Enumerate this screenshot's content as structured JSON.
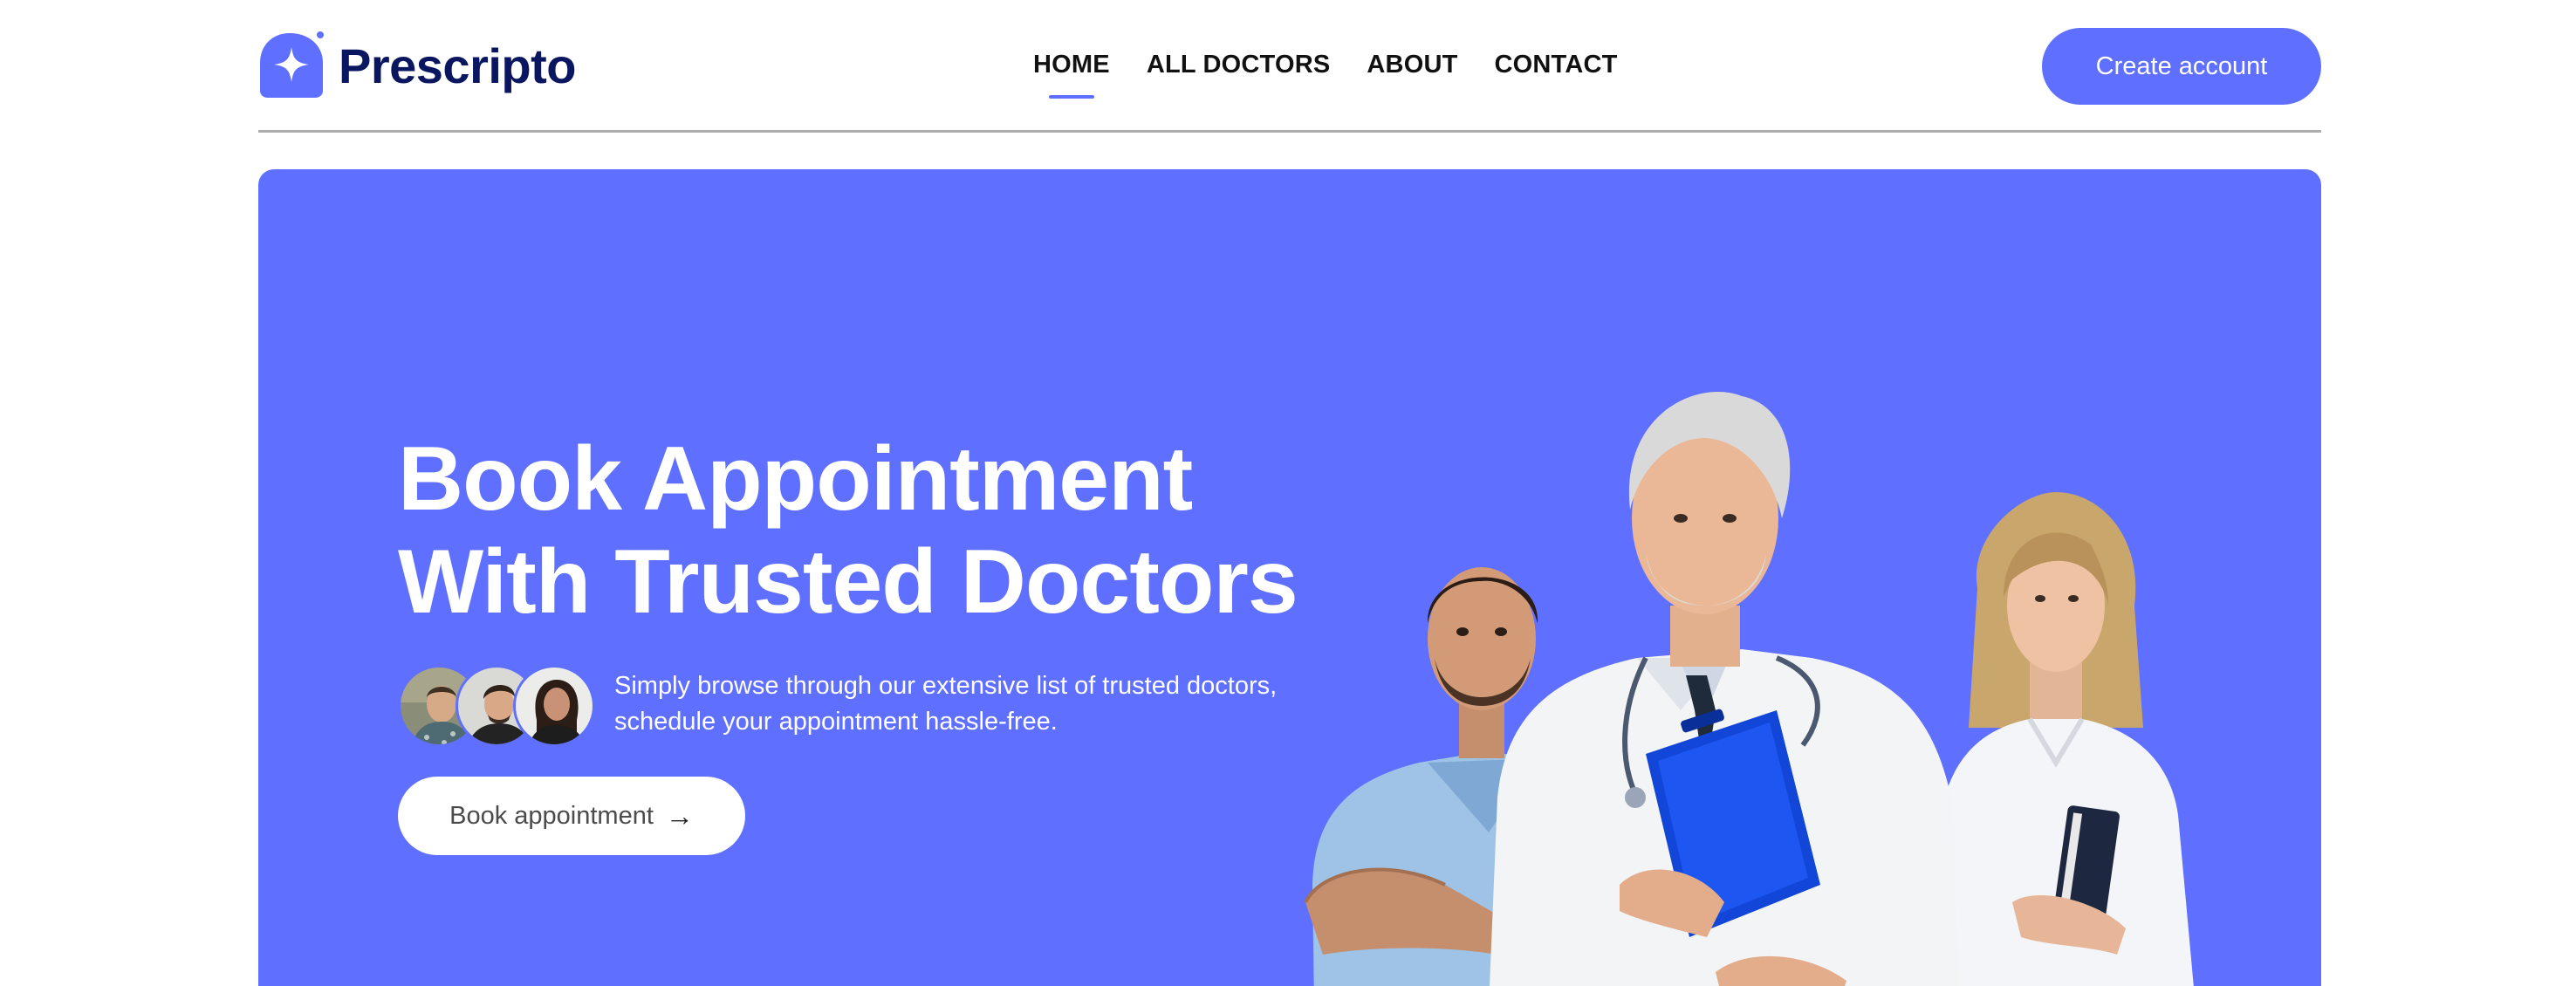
{
  "brand": {
    "name": "Prescripto"
  },
  "nav": {
    "links": [
      {
        "label": "HOME",
        "active": true
      },
      {
        "label": "ALL DOCTORS",
        "active": false
      },
      {
        "label": "ABOUT",
        "active": false
      },
      {
        "label": "CONTACT",
        "active": false
      }
    ],
    "create_account_label": "Create account"
  },
  "hero": {
    "title_line1": "Book Appointment",
    "title_line2": "With Trusted Doctors",
    "description_line1": "Simply browse through our extensive list of trusted doctors,",
    "description_line2": "schedule your appointment hassle-free.",
    "cta_label": "Book appointment",
    "cta_icon": "arrow-right-icon"
  },
  "colors": {
    "primary": "#5F6FFF",
    "brand_text": "#0A1660",
    "divider": "#ADADAD"
  }
}
